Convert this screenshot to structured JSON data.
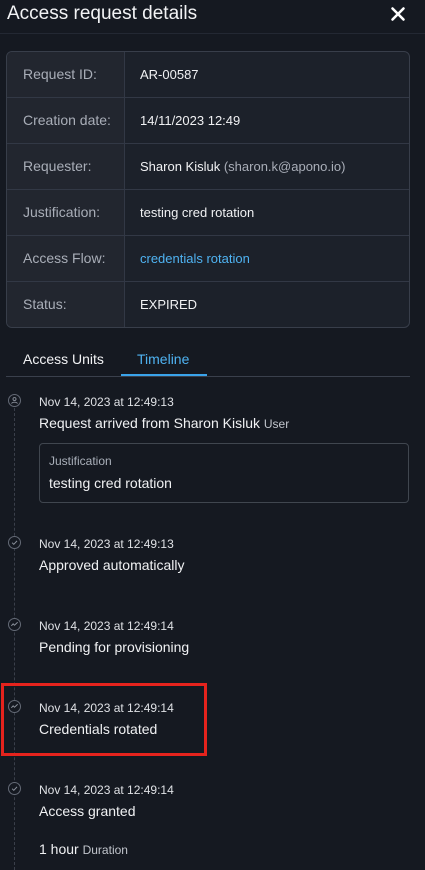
{
  "header": {
    "title": "Access request details",
    "close_icon": "close-icon"
  },
  "details": [
    {
      "label": "Request ID:",
      "value": "AR-00587"
    },
    {
      "label": "Creation date:",
      "value": "14/11/2023 12:49"
    },
    {
      "label": "Requester:",
      "value": "Sharon Kisluk",
      "value_secondary": "(sharon.k@apono.io)"
    },
    {
      "label": "Justification:",
      "value": "testing cred rotation"
    },
    {
      "label": "Access Flow:",
      "value": "credentials rotation"
    },
    {
      "label": "Status:",
      "value": "EXPIRED"
    }
  ],
  "tabs": [
    {
      "label": "Access Units",
      "active": false
    },
    {
      "label": "Timeline",
      "active": true
    }
  ],
  "timeline": [
    {
      "icon": "user-icon",
      "time": "Nov 14, 2023 at 12:49:13",
      "text": "Request arrived from Sharon Kisluk",
      "text_secondary": "User",
      "justification": {
        "label": "Justification",
        "value": "testing cred rotation"
      }
    },
    {
      "icon": "check-icon",
      "time": "Nov 14, 2023 at 12:49:13",
      "text": "Approved automatically"
    },
    {
      "icon": "activity-icon",
      "time": "Nov 14, 2023 at 12:49:14",
      "text": "Pending for provisioning"
    },
    {
      "icon": "activity-icon",
      "time": "Nov 14, 2023 at 12:49:14",
      "text": "Credentials rotated",
      "highlighted": true
    },
    {
      "icon": "check-icon",
      "time": "Nov 14, 2023 at 12:49:14",
      "text": "Access granted"
    }
  ],
  "duration": {
    "value": "1 hour",
    "label": "Duration"
  },
  "colors": {
    "background": "#151921",
    "accent": "#4fb3f2",
    "highlight": "#e5231d"
  }
}
